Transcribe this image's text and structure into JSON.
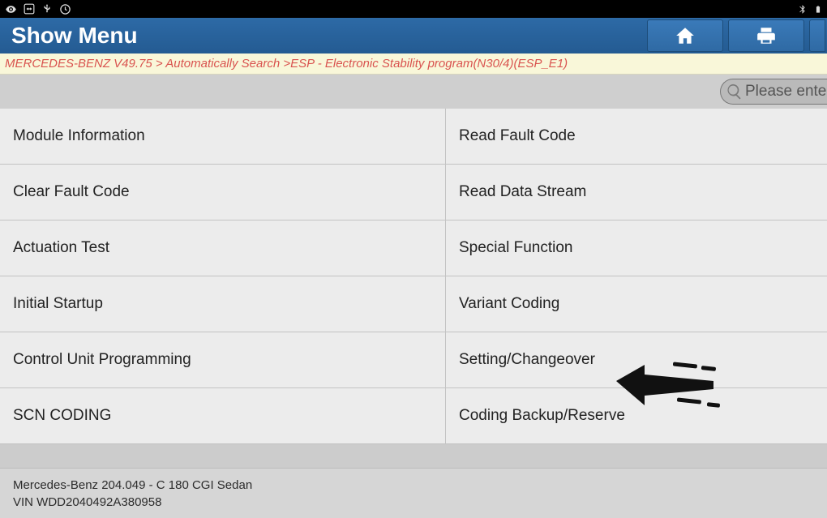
{
  "title": "Show Menu",
  "breadcrumb": "MERCEDES-BENZ V49.75 > Automatically Search >ESP - Electronic Stability program(N30/4)(ESP_E1)",
  "search": {
    "placeholder": "Please enter"
  },
  "menu": [
    {
      "label": "Module Information"
    },
    {
      "label": "Read Fault Code"
    },
    {
      "label": "Clear Fault Code"
    },
    {
      "label": "Read Data Stream"
    },
    {
      "label": "Actuation Test"
    },
    {
      "label": "Special Function"
    },
    {
      "label": "Initial Startup"
    },
    {
      "label": "Variant Coding"
    },
    {
      "label": "Control Unit Programming"
    },
    {
      "label": "Setting/Changeover"
    },
    {
      "label": "SCN CODING"
    },
    {
      "label": "Coding Backup/Reserve"
    }
  ],
  "footer": {
    "line1": "Mercedes-Benz 204.049 - C 180 CGI Sedan",
    "line2": "VIN WDD2040492A380958"
  }
}
